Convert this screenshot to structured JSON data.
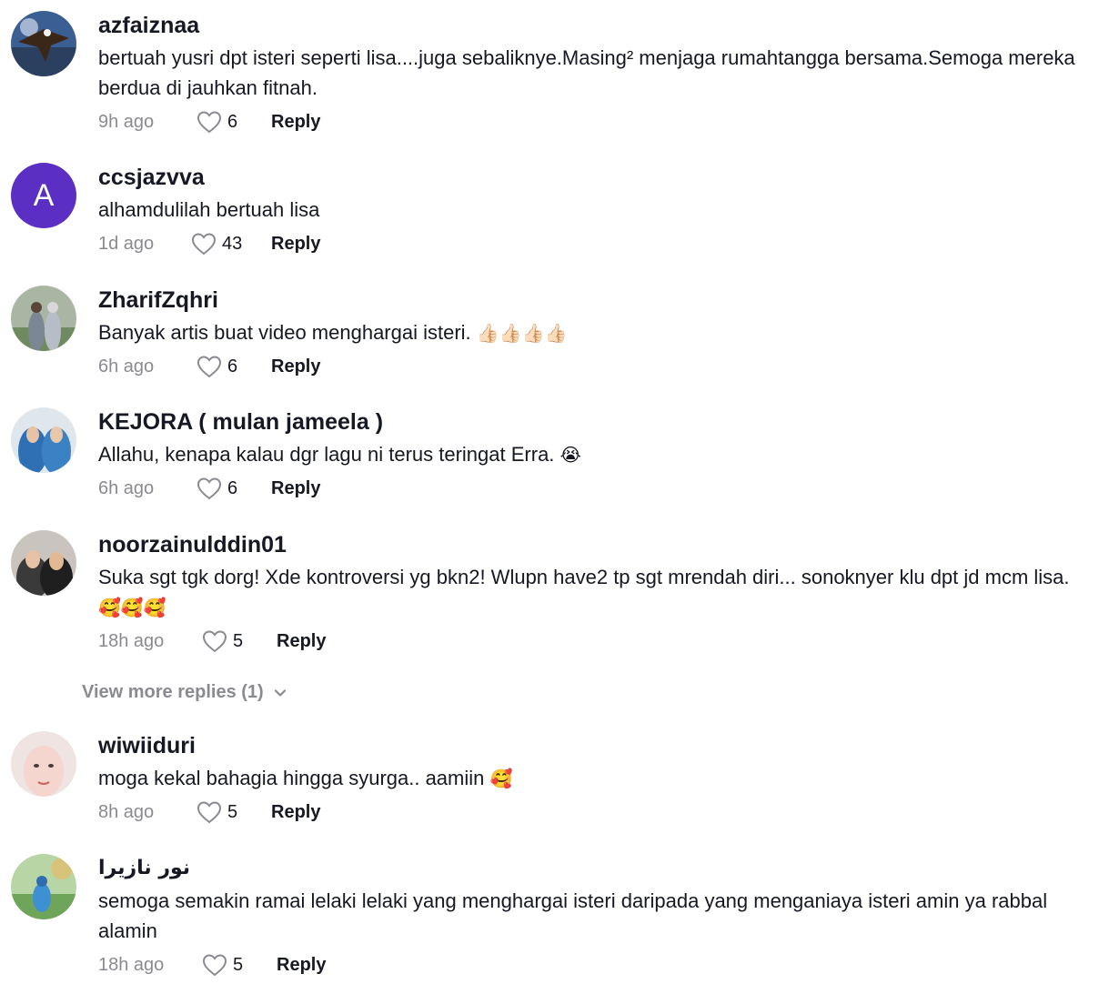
{
  "comments": [
    {
      "username": "azfaiznaa",
      "text": "bertuah yusri dpt isteri seperti lisa....juga sebaliknye.Masing² menjaga rumahtangga bersama.Semoga mereka berdua di jauhkan fitnah.",
      "time": "9h ago",
      "likes": "6",
      "reply": "Reply",
      "avatar_icon": "eagle-photo-avatar"
    },
    {
      "username": "ccsjazvva",
      "text": "alhamdulilah bertuah lisa",
      "time": "1d ago",
      "likes": "43",
      "reply": "Reply",
      "avatar_letter": "A",
      "avatar_color": "#5b2fc4"
    },
    {
      "username": "ZharifZqhri",
      "text": "Banyak artis buat video menghargai isteri.",
      "emoji": "👍🏻👍🏻👍🏻👍🏻",
      "time": "6h ago",
      "likes": "6",
      "reply": "Reply",
      "avatar_icon": "couple-photo-avatar"
    },
    {
      "username": "KEJORA ( mulan jameela )",
      "text": "Allahu, kenapa kalau dgr lagu ni terus teringat Erra.",
      "emoji": "😭",
      "time": "6h ago",
      "likes": "6",
      "reply": "Reply",
      "avatar_icon": "hijab-women-photo-avatar"
    },
    {
      "username": "noorzainulddin01",
      "text": "Suka sgt tgk dorg! Xde kontroversi yg bkn2! Wlupn have2 tp sgt mrendah diri... sonoknyer klu dpt jd mcm lisa.",
      "emoji": "🥰🥰🥰",
      "time": "18h ago",
      "likes": "5",
      "reply": "Reply",
      "avatar_icon": "selfie-photo-avatar"
    },
    {
      "username": "wiwiiduri",
      "text": "moga kekal bahagia hingga syurga.. aamiin",
      "emoji": "🥰",
      "time": "8h ago",
      "likes": "5",
      "reply": "Reply",
      "avatar_icon": "face-photo-avatar"
    },
    {
      "username": "نور نازيرا",
      "text": "semoga semakin ramai lelaki lelaki yang menghargai isteri daripada yang menganiaya isteri amin ya rabbal alamin",
      "time": "18h ago",
      "likes": "5",
      "reply": "Reply",
      "avatar_icon": "outdoor-photo-avatar"
    }
  ],
  "view_more": {
    "label": "View more replies (1)"
  },
  "colors": {
    "text": "#161823",
    "muted": "#8a8b91",
    "avatar_purple": "#5b2fc4"
  }
}
